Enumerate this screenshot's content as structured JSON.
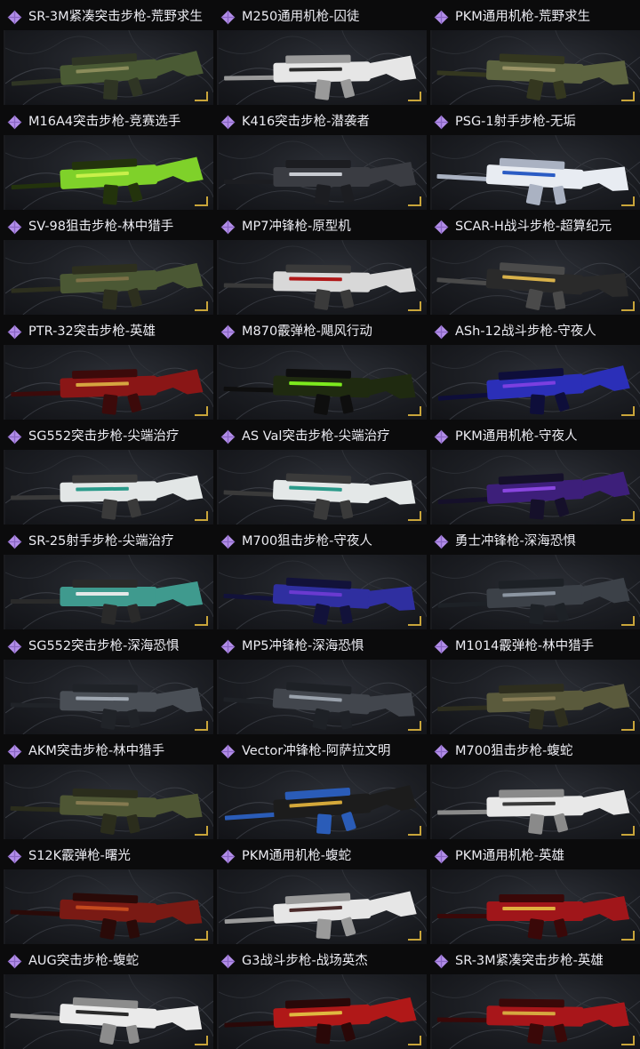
{
  "items": [
    {
      "label": "SR-3M紧凑突击步枪-荒野求生",
      "skin": [
        "#4a5a34",
        "#8a8b5a",
        "#2f3524"
      ]
    },
    {
      "label": "M250通用机枪-囚徒",
      "skin": [
        "#e6e6e6",
        "#2a2a2a",
        "#9a9a9a"
      ]
    },
    {
      "label": "PKM通用机枪-荒野求生",
      "skin": [
        "#5d6440",
        "#9b9467",
        "#34371f"
      ]
    },
    {
      "label": "M16A4突击步枪-竞赛选手",
      "skin": [
        "#7fd12a",
        "#c8f04a",
        "#23330c"
      ]
    },
    {
      "label": "K416突击步枪-潜袭者",
      "skin": [
        "#3a3c42",
        "#c9ccd2",
        "#1c1d21"
      ]
    },
    {
      "label": "PSG-1射手步枪-无垢",
      "skin": [
        "#e8ecf2",
        "#2b5cc4",
        "#aab2c2"
      ]
    },
    {
      "label": "SV-98狙击步枪-林中猎手",
      "skin": [
        "#4b5834",
        "#7c7047",
        "#2d2f1e"
      ]
    },
    {
      "label": "MP7冲锋枪-原型机",
      "skin": [
        "#d8d8d8",
        "#b01818",
        "#3a3a3a"
      ]
    },
    {
      "label": "SCAR-H战斗步枪-超算纪元",
      "skin": [
        "#2a2a2a",
        "#d8b14a",
        "#4a4a4a"
      ]
    },
    {
      "label": "PTR-32突击步枪-英雄",
      "skin": [
        "#8a1616",
        "#d6a640",
        "#3c0a0a"
      ]
    },
    {
      "label": "M870霰弹枪-飓风行动",
      "skin": [
        "#1f2a10",
        "#7dea1e",
        "#0e0e0e"
      ]
    },
    {
      "label": "ASh-12战斗步枪-守夜人",
      "skin": [
        "#2b2fb8",
        "#7b3fe0",
        "#0e0e3a"
      ]
    },
    {
      "label": "SG552突击步枪-尖端治疗",
      "skin": [
        "#e2e6e6",
        "#2a9a8a",
        "#3a3a3a"
      ]
    },
    {
      "label": "AS Val突击步枪-尖端治疗",
      "skin": [
        "#e4e8e8",
        "#2a9a8a",
        "#3a3a3a"
      ]
    },
    {
      "label": "PKM通用机枪-守夜人",
      "skin": [
        "#3d1f7a",
        "#8a46e0",
        "#15102a"
      ]
    },
    {
      "label": "SR-25射手步枪-尖端治疗",
      "skin": [
        "#3f9a8e",
        "#e4e8e8",
        "#2a2a2a"
      ]
    },
    {
      "label": "M700狙击步枪-守夜人",
      "skin": [
        "#2f2fa0",
        "#6a3ad0",
        "#12123a"
      ]
    },
    {
      "label": "勇士冲锋枪-深海恐惧",
      "skin": [
        "#3c4148",
        "#8c96a2",
        "#1d2126"
      ]
    },
    {
      "label": "SG552突击步枪-深海恐惧",
      "skin": [
        "#4a4f56",
        "#a0a8b2",
        "#202328"
      ]
    },
    {
      "label": "MP5冲锋枪-深海恐惧",
      "skin": [
        "#42464d",
        "#9aa2ac",
        "#1e2126"
      ]
    },
    {
      "label": "M1014霰弹枪-林中猎手",
      "skin": [
        "#5a5a3c",
        "#8a7e56",
        "#2e2e1e"
      ]
    },
    {
      "label": "AKM突击步枪-林中猎手",
      "skin": [
        "#4e5634",
        "#857a50",
        "#2b2d1c"
      ]
    },
    {
      "label": "Vector冲锋枪-阿萨拉文明",
      "skin": [
        "#1c1c1c",
        "#d4a83a",
        "#2a5cb8"
      ]
    },
    {
      "label": "M700狙击步枪-蝮蛇",
      "skin": [
        "#e8e8e8",
        "#3a3a3a",
        "#8a8a8a"
      ]
    },
    {
      "label": "S12K霰弹枪-曙光",
      "skin": [
        "#7a1a14",
        "#c44a1e",
        "#2a0a08"
      ]
    },
    {
      "label": "PKM通用机枪-蝮蛇",
      "skin": [
        "#e6e6e6",
        "#4a2a2a",
        "#9a9a9a"
      ]
    },
    {
      "label": "PKM通用机枪-英雄",
      "skin": [
        "#a0161a",
        "#e0b040",
        "#3a0808"
      ]
    },
    {
      "label": "AUG突击步枪-蝮蛇",
      "skin": [
        "#eaeaea",
        "#2a2a2a",
        "#8c8c8c"
      ]
    },
    {
      "label": "G3战斗步枪-战场英杰",
      "skin": [
        "#b01818",
        "#e0b840",
        "#2a0808"
      ]
    },
    {
      "label": "SR-3M紧凑突击步枪-英雄",
      "skin": [
        "#a8161a",
        "#d6a840",
        "#3a0808"
      ]
    }
  ],
  "theme": {
    "rarity_color": "#b28ee8",
    "corner_color": "#c9a53a"
  }
}
